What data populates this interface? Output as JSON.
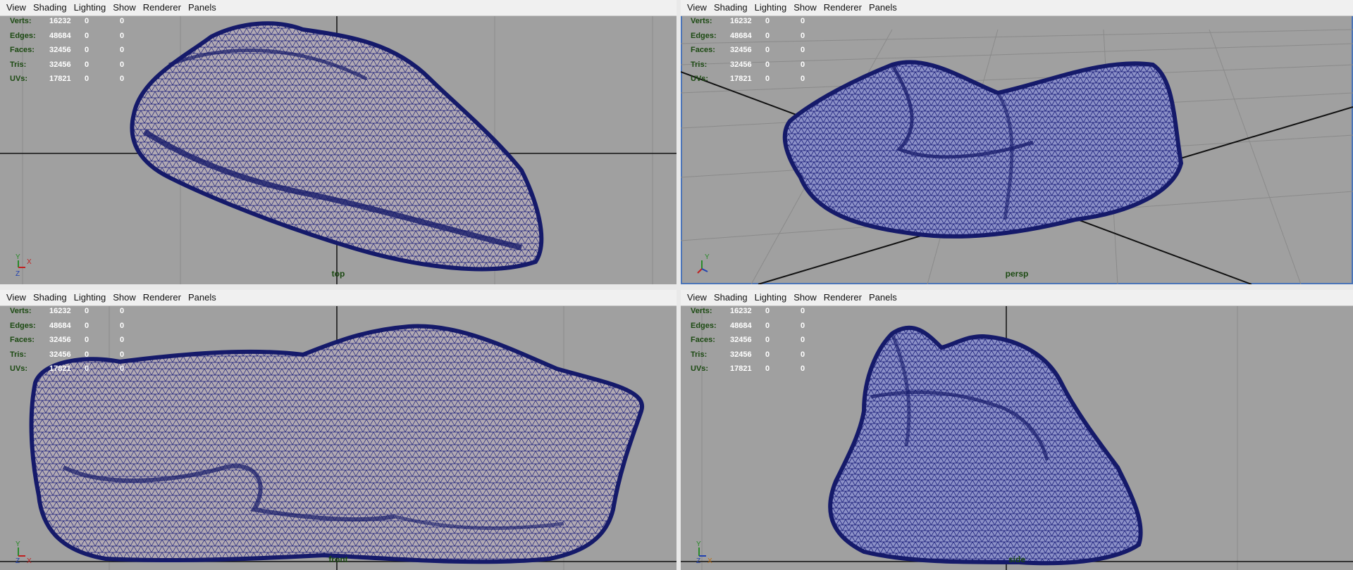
{
  "menu": [
    "View",
    "Shading",
    "Lighting",
    "Show",
    "Renderer",
    "Panels"
  ],
  "hud": {
    "labels": [
      "Verts:",
      "Edges:",
      "Faces:",
      "Tris:",
      "UVs:"
    ],
    "values": [
      "16232",
      "48684",
      "32456",
      "32456",
      "17821"
    ],
    "sel_a": [
      "0",
      "0",
      "0",
      "0",
      "0"
    ],
    "sel_b": [
      "0",
      "0",
      "0",
      "0",
      "0"
    ]
  },
  "viewports": {
    "top": {
      "camera": "top",
      "axis": [
        "Y",
        "X",
        "Z"
      ]
    },
    "persp": {
      "camera": "persp",
      "axis": [
        "Y",
        "X",
        "Z"
      ]
    },
    "front": {
      "camera": "front",
      "axis": [
        "Y",
        "Z",
        "X"
      ]
    },
    "side": {
      "camera": "side",
      "axis": [
        "Y",
        "Z",
        "X"
      ]
    }
  },
  "colors": {
    "viewport_bg": "#a0a0a0",
    "mesh_wire": "#1b1f7a",
    "mesh_fill": "#b7aeb0",
    "hud_label": "#1c4a12",
    "active_border": "#4a74b8"
  }
}
